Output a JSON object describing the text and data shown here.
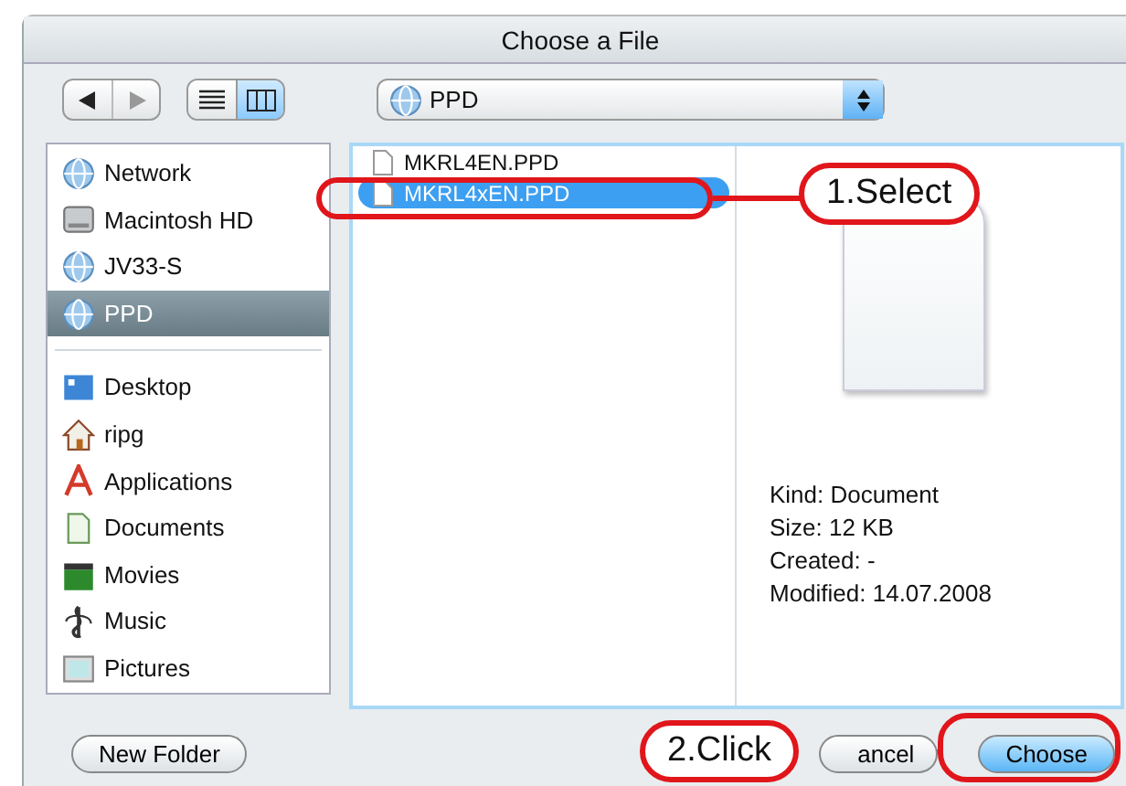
{
  "window": {
    "title": "Choose a File"
  },
  "view_modes": [
    {
      "kind": "list",
      "selected": false
    },
    {
      "kind": "columns",
      "selected": true
    }
  ],
  "location": {
    "label": "PPD"
  },
  "sidebar": {
    "devices": [
      {
        "label": "Network",
        "kind": "network",
        "selected": false
      },
      {
        "label": "Macintosh HD",
        "kind": "disk",
        "selected": false
      },
      {
        "label": "JV33-S",
        "kind": "network",
        "selected": false
      },
      {
        "label": "PPD",
        "kind": "network",
        "selected": true
      }
    ],
    "places": [
      {
        "label": "Desktop",
        "kind": "desktop",
        "selected": false
      },
      {
        "label": "ripg",
        "kind": "home",
        "selected": false
      },
      {
        "label": "Applications",
        "kind": "apps",
        "selected": false
      },
      {
        "label": "Documents",
        "kind": "docs",
        "selected": false
      },
      {
        "label": "Movies",
        "kind": "movies",
        "selected": false
      },
      {
        "label": "Music",
        "kind": "music",
        "selected": false
      },
      {
        "label": "Pictures",
        "kind": "pictures",
        "selected": false
      }
    ]
  },
  "files": [
    {
      "name": "MKRL4EN.PPD",
      "selected": false
    },
    {
      "name": "MKRL4xEN.PPD",
      "selected": true
    }
  ],
  "preview": {
    "info": [
      "Kind: Document",
      "Size: 12 KB",
      "Created: -",
      "Modified: 14.07.2008"
    ]
  },
  "buttons": {
    "new_folder": "New Folder",
    "cancel": "ancel",
    "choose": "Choose"
  },
  "callouts": [
    {
      "text": "1.Select"
    },
    {
      "text": "2.Click"
    }
  ]
}
